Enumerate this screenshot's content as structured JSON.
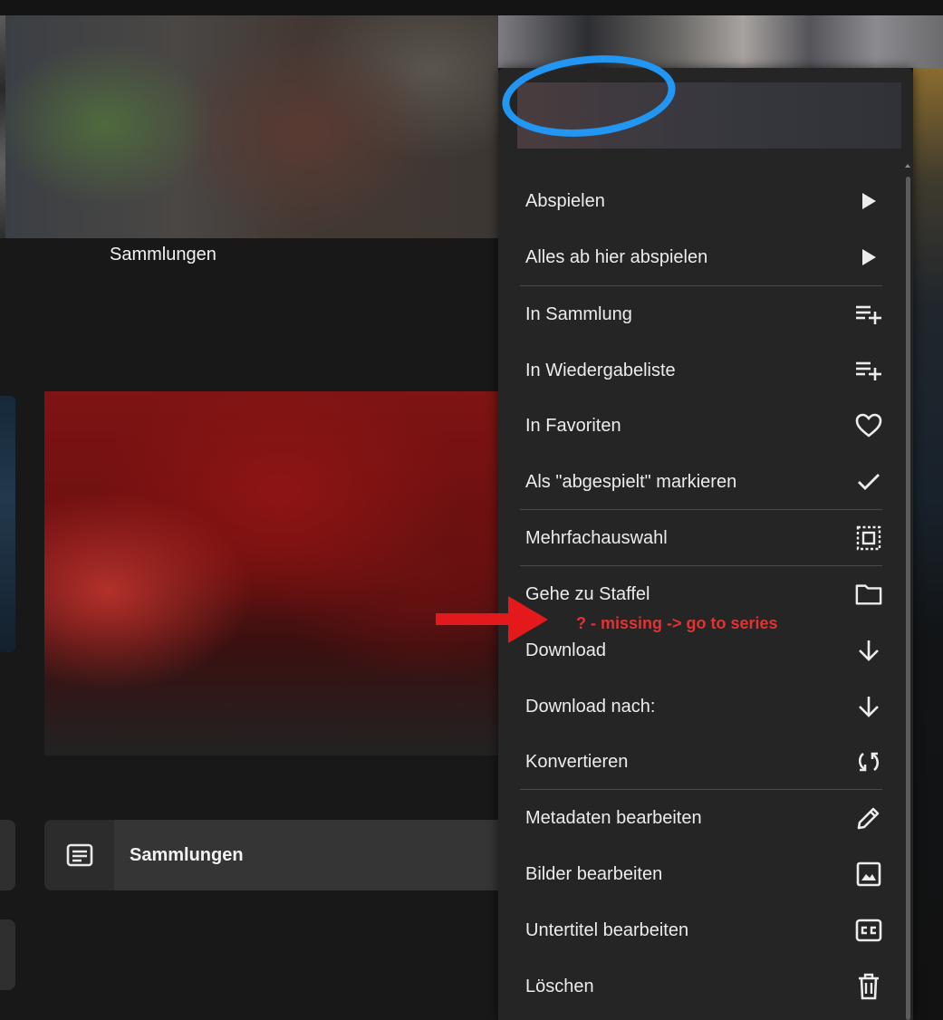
{
  "background": {
    "caption": "Sammlungen"
  },
  "collection_button": {
    "label": "Sammlungen",
    "icon": "document-list-icon"
  },
  "menu": {
    "items": [
      {
        "label": "Abspielen",
        "icon": "play-icon"
      },
      {
        "label": "Alles ab hier abspielen",
        "icon": "play-icon"
      },
      {
        "label": "In Sammlung",
        "icon": "playlist-add-icon"
      },
      {
        "label": "In Wiedergabeliste",
        "icon": "playlist-add-icon"
      },
      {
        "label": "In Favoriten",
        "icon": "heart-icon"
      },
      {
        "label": "Als \"abgespielt\" markieren",
        "icon": "check-icon"
      },
      {
        "label": "Mehrfachauswahl",
        "icon": "select-all-icon"
      },
      {
        "label": "Gehe zu Staffel",
        "icon": "folder-icon"
      },
      {
        "label": "Download",
        "icon": "download-icon"
      },
      {
        "label": "Download nach:",
        "icon": "download-icon"
      },
      {
        "label": "Konvertieren",
        "icon": "convert-icon"
      },
      {
        "label": "Metadaten bearbeiten",
        "icon": "pencil-icon"
      },
      {
        "label": "Bilder bearbeiten",
        "icon": "image-icon"
      },
      {
        "label": "Untertitel bearbeiten",
        "icon": "subtitles-icon"
      },
      {
        "label": "Löschen",
        "icon": "trash-icon"
      }
    ]
  },
  "annotation": {
    "text": "? - missing -> go to series",
    "color": "#e23232",
    "circle_color": "#2196f3"
  }
}
